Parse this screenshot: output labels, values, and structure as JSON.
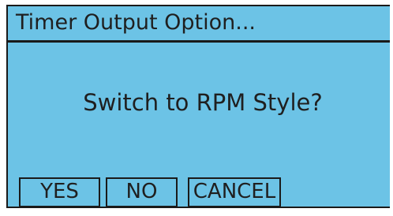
{
  "dialog": {
    "title": "Timer Output Option...",
    "message": "Switch to RPM Style?",
    "buttons": {
      "yes": "YES",
      "no": "NO",
      "cancel": "CANCEL"
    }
  },
  "colors": {
    "screen_background": "#6cc3e6",
    "border": "#1a1a1a",
    "text": "#1f1f1f"
  }
}
